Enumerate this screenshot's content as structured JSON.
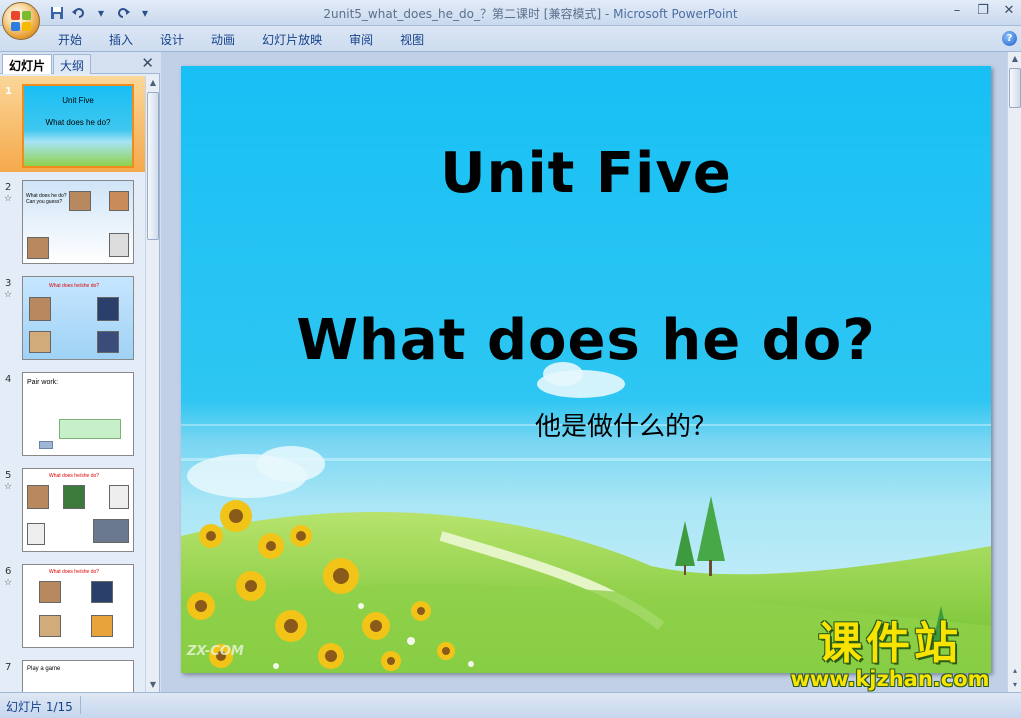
{
  "window": {
    "title_doc": "2unit5_what_does_he_do_？第二课时 [兼容模式]",
    "title_sep": " - ",
    "title_app": "Microsoft PowerPoint"
  },
  "quick_access": {
    "icons": [
      "save-icon",
      "undo-icon",
      "redo-icon",
      "customize-icon"
    ]
  },
  "ribbon": {
    "tabs": [
      "开始",
      "插入",
      "设计",
      "动画",
      "幻灯片放映",
      "审阅",
      "视图"
    ]
  },
  "left_panel": {
    "tabs": [
      "幻灯片",
      "大纲"
    ],
    "slides": [
      {
        "num": "1",
        "title": "Unit Five",
        "line": "What does he do?"
      },
      {
        "num": "2",
        "title": "What does he do?",
        "line": "Can you guess?"
      },
      {
        "num": "3",
        "title": "What does he/she do?",
        "line": ""
      },
      {
        "num": "4",
        "title": "Pair work:",
        "line": ""
      },
      {
        "num": "5",
        "title": "What does he/she do?",
        "line": ""
      },
      {
        "num": "6",
        "title": "What does he/she do?",
        "line": ""
      },
      {
        "num": "7",
        "title": "Play a game",
        "line": ""
      }
    ]
  },
  "slide": {
    "title": "Unit Five",
    "subtitle": "What does he do?",
    "chinese": "他是做什么的？",
    "watermark": "ZX-COM"
  },
  "brand": {
    "cn": "课件站",
    "url": "www.kjzhan.com"
  },
  "status": {
    "text": "幻灯片 1/15"
  },
  "colors": {
    "sky": "#1ec4f5",
    "grass": "#8fd14a",
    "accent": "#f08b1d",
    "brand_yellow": "#f9e300"
  }
}
